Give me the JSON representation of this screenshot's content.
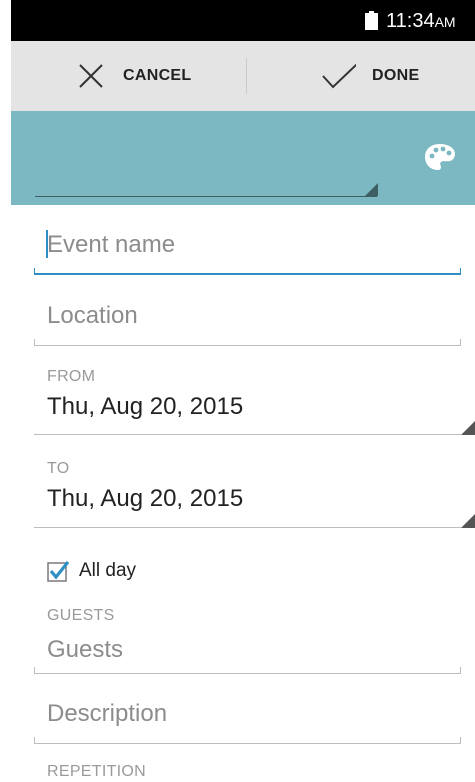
{
  "status_bar": {
    "time": "11:34",
    "ampm": "AM",
    "icons": [
      "battery-icon"
    ]
  },
  "action_bar": {
    "cancel_label": "CANCEL",
    "done_label": "DONE",
    "icons": [
      "close-icon",
      "check-icon"
    ]
  },
  "color_bar": {
    "color": "#7bb8c1",
    "icons": [
      "palette-icon"
    ]
  },
  "form": {
    "event_name": {
      "value": "",
      "placeholder": "Event name"
    },
    "location": {
      "value": "",
      "placeholder": "Location"
    },
    "from": {
      "caption": "FROM",
      "value": "Thu, Aug 20, 2015"
    },
    "to": {
      "caption": "TO",
      "value": "Thu, Aug 20, 2015"
    },
    "all_day": {
      "label": "All day",
      "checked": true
    },
    "guests": {
      "caption": "GUESTS",
      "placeholder": "Guests"
    },
    "description": {
      "placeholder": "Description"
    },
    "repetition": {
      "caption": "REPETITION"
    }
  },
  "colors": {
    "accent": "#2f8fc4",
    "event_color": "#7bb8c1",
    "action_bar": "#e4e4e4"
  }
}
